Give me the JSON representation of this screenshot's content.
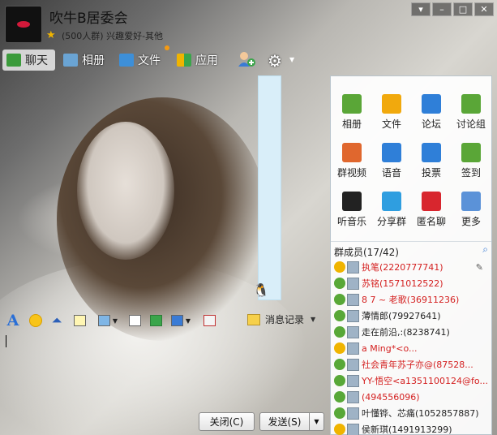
{
  "header": {
    "group_name": "吹牛B居委会",
    "description": "(500人群) 兴趣爱好-其他"
  },
  "tabs": [
    {
      "label": "聊天"
    },
    {
      "label": "相册"
    },
    {
      "label": "文件"
    },
    {
      "label": "应用"
    }
  ],
  "toolbar": {
    "history_label": "消息记录"
  },
  "buttons": {
    "close_label": "关闭(C)",
    "send_label": "发送(S)"
  },
  "apps": [
    {
      "label": "相册",
      "icon": "album-icon",
      "color": "#5aa637"
    },
    {
      "label": "文件",
      "icon": "folder-icon",
      "color": "#f1a90d"
    },
    {
      "label": "论坛",
      "icon": "forum-icon",
      "color": "#2f7fd8"
    },
    {
      "label": "讨论组",
      "icon": "discussion-icon",
      "color": "#5aa637"
    },
    {
      "label": "群视频",
      "icon": "video-icon",
      "color": "#e0672e"
    },
    {
      "label": "语音",
      "icon": "voice-icon",
      "color": "#2f7fd8"
    },
    {
      "label": "投票",
      "icon": "vote-icon",
      "color": "#2f7fd8"
    },
    {
      "label": "签到",
      "icon": "checkin-icon",
      "color": "#5aa637"
    },
    {
      "label": "听音乐",
      "icon": "music-icon",
      "color": "#222222"
    },
    {
      "label": "分享群",
      "icon": "share-icon",
      "color": "#2f9ee0"
    },
    {
      "label": "匿名聊",
      "icon": "anonymous-icon",
      "color": "#d8262e"
    },
    {
      "label": "更多",
      "icon": "more-icon",
      "color": "#5b92d8"
    }
  ],
  "members": {
    "title": "群成员(17/42)",
    "list": [
      {
        "name": "执笔(2220777741)",
        "color": "red"
      },
      {
        "name": "苏铭(1571012522)",
        "color": "red"
      },
      {
        "name": "8 7 ~ 老歌(36911236)",
        "color": "red"
      },
      {
        "name": "薄情郎(79927641)",
        "color": "dark"
      },
      {
        "name": "走在前沿,:(8238741)",
        "color": "dark"
      },
      {
        "name": "a                    Ming*<o...",
        "color": "red"
      },
      {
        "name": "社会青年苏子亦@(87528...",
        "color": "red"
      },
      {
        "name": "YY-悟空<a1351100124@fo...",
        "color": "red"
      },
      {
        "name": "(494556096)",
        "color": "red"
      },
      {
        "name": "叶懂铧、芯痛(1052857887)",
        "color": "dark"
      },
      {
        "name": "侯新琪(1491913299)",
        "color": "dark"
      }
    ]
  }
}
